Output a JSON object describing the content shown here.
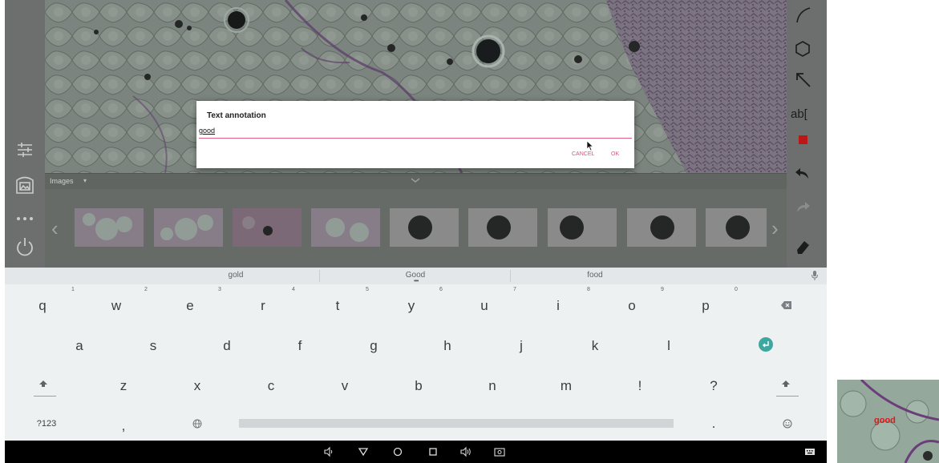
{
  "dialog": {
    "title": "Text annotation",
    "input_value": "good",
    "cancel_label": "CANCEL",
    "ok_label": "OK"
  },
  "images_bar": {
    "label": "Images",
    "caret": "▾"
  },
  "thumbnails": [
    {
      "kind": "tissue"
    },
    {
      "kind": "tissue"
    },
    {
      "kind": "tissue-dark"
    },
    {
      "kind": "tissue"
    },
    {
      "kind": "dark-circle"
    },
    {
      "kind": "dark-circle"
    },
    {
      "kind": "dark-circle"
    },
    {
      "kind": "dark-circle"
    },
    {
      "kind": "dark-circle"
    }
  ],
  "left_toolbar": [
    "sliders-icon",
    "image-frame-icon",
    "more-dots-icon",
    "power-icon"
  ],
  "right_toolbar": [
    "arc-tool-icon",
    "polygon-tool-icon",
    "arrow-tool-icon",
    "text-tool-icon",
    "color-swatch-icon",
    "undo-icon",
    "redo-icon",
    "eraser-icon"
  ],
  "right_toolbar_text": {
    "text_tool": "ab["
  },
  "colors": {
    "annotation": "#d81a1a",
    "accent": "#e0507a",
    "enter": "#3ea8a0"
  },
  "keyboard": {
    "suggestions": [
      "gold",
      "Good",
      "food"
    ],
    "row1": [
      "q",
      "w",
      "e",
      "r",
      "t",
      "y",
      "u",
      "i",
      "o",
      "p"
    ],
    "row1_hints": [
      "1",
      "2",
      "3",
      "4",
      "5",
      "6",
      "7",
      "8",
      "9",
      "0"
    ],
    "row2": [
      "a",
      "s",
      "d",
      "f",
      "g",
      "h",
      "j",
      "k",
      "l"
    ],
    "row3": [
      "z",
      "x",
      "c",
      "v",
      "b",
      "n",
      "m",
      "!",
      "?"
    ],
    "row4": {
      "symbols": "?123",
      "comma": ",",
      "period": "."
    }
  },
  "preview": {
    "text": "good"
  }
}
